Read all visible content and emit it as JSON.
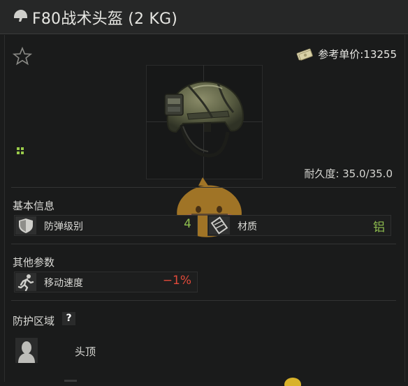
{
  "header": {
    "title": "F80战术头盔 (2 KG)",
    "icon": "helmet-icon"
  },
  "item": {
    "favorite_icon": "star-outline-icon",
    "price_icon": "money-icon",
    "price_text": "参考单价:13255",
    "durability_text": "耐久度: 35.0/35.0",
    "inventory_icon": "grid-size-icon"
  },
  "basic_info": {
    "title": "基本信息",
    "stats": [
      {
        "icon": "shield-icon",
        "label": "防弹级别",
        "value": "4",
        "value_color": "#8fbf4f"
      },
      {
        "icon": "material-icon",
        "label": "材质",
        "value": "铝",
        "value_color": "#8fbf4f"
      }
    ]
  },
  "other_params": {
    "title": "其他参数",
    "stats": [
      {
        "icon": "running-man-icon",
        "label": "移动速度",
        "value": "−1%",
        "value_color": "#e04a3a"
      }
    ]
  },
  "protection": {
    "title": "防护区域",
    "help_label": "?",
    "zones": [
      {
        "icon": "head-silhouette-icon",
        "label": "头顶"
      }
    ]
  },
  "colors": {
    "accent_green": "#8fbf4f",
    "negative_red": "#e04a3a",
    "panel_bg": "#1a1b1b"
  }
}
